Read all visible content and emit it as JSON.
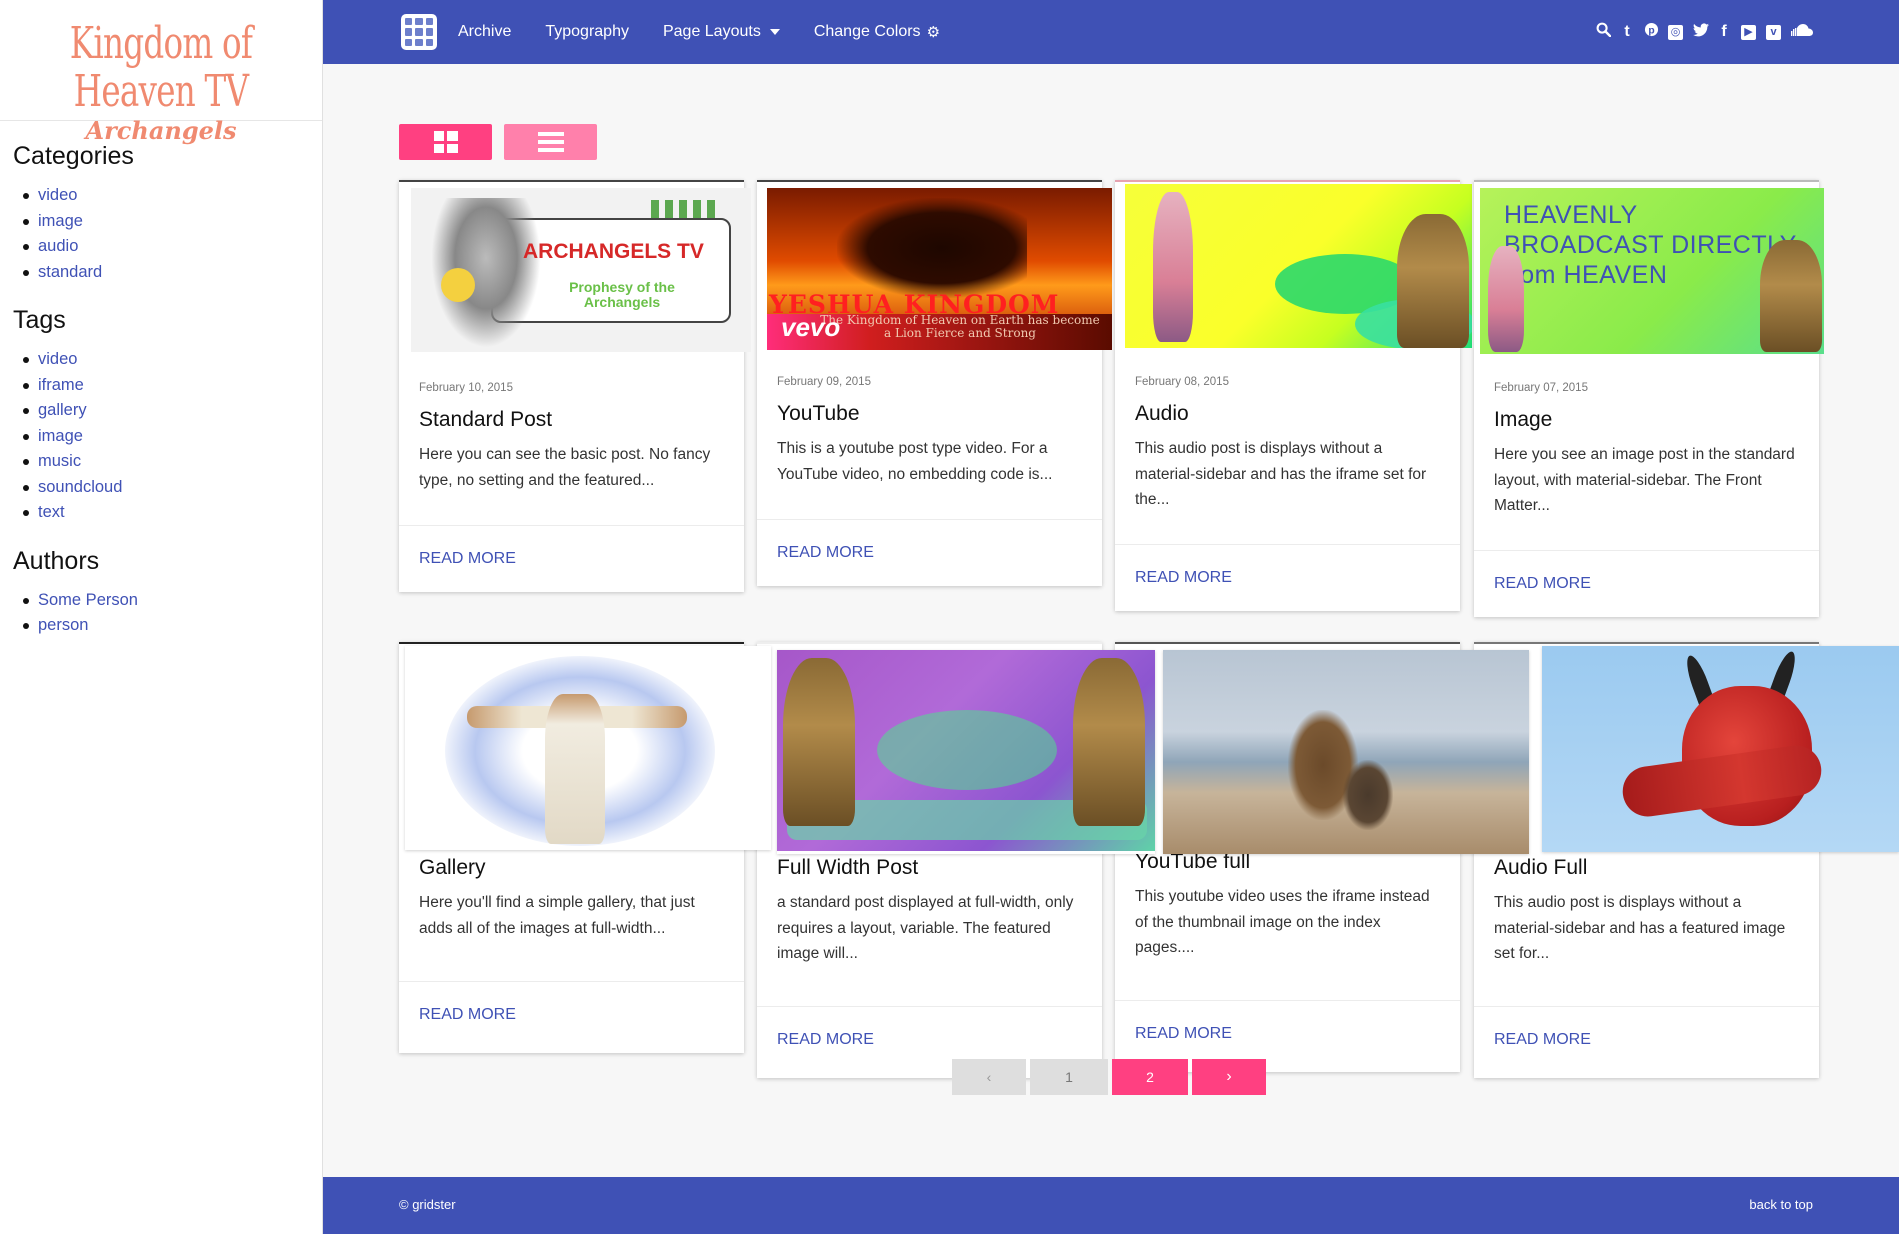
{
  "logo": {
    "title": "Kingdom of Heaven TV",
    "subtitle": "Archangels"
  },
  "sidebar": {
    "categories": {
      "heading": "Categories",
      "items": [
        "video",
        "image",
        "audio",
        "standard"
      ]
    },
    "tags": {
      "heading": "Tags",
      "items": [
        "video",
        "iframe",
        "gallery",
        "image",
        "music",
        "soundcloud",
        "text"
      ]
    },
    "authors": {
      "heading": "Authors",
      "items": [
        "Some Person",
        "person"
      ]
    }
  },
  "nav": {
    "archive": "Archive",
    "typography": "Typography",
    "page_layouts": "Page Layouts",
    "change_colors": "Change Colors"
  },
  "social_icons": [
    "search-icon",
    "tumblr-icon",
    "pinterest-icon",
    "instagram-icon",
    "twitter-icon",
    "facebook-icon",
    "youtube-icon",
    "vimeo-icon",
    "soundcloud-icon"
  ],
  "colors": {
    "primary": "#3f51b5",
    "accent": "#ff4081",
    "accent_light": "#ff80ab",
    "background": "#f7f7f7"
  },
  "posts": [
    {
      "date": "February 10, 2015",
      "title": "Standard Post",
      "excerpt": "Here you can see the basic post. No fancy type, no setting and the featured...",
      "read_more": "READ MORE",
      "image_text": "ARCHANGELS TV",
      "image_caption": "Prophesy of the Archangels"
    },
    {
      "date": "February 09, 2015",
      "title": "YouTube",
      "excerpt": "This is a youtube post type video. For a YouTube video, no embedding code is...",
      "read_more": "READ MORE",
      "image_text": "YESHUA KINGDOM",
      "image_brand": "vevo",
      "image_caption": "The Kingdom of Heaven on Earth has become a Lion Fierce and Strong"
    },
    {
      "date": "February 08, 2015",
      "title": "Audio",
      "excerpt": "This audio post is displays without a material-sidebar and has the iframe set for the...",
      "read_more": "READ MORE"
    },
    {
      "date": "February 07, 2015",
      "title": "Image",
      "excerpt": "Here you see an image post in the standard layout, with material-sidebar. The Front Matter...",
      "read_more": "READ MORE",
      "image_text": "HEAVENLY   BROADCAST DIRECTLY from HEAVEN"
    },
    {
      "title": "Gallery",
      "excerpt": "Here you'll find a simple gallery, that just adds all of the images at full-width...",
      "read_more": "READ MORE"
    },
    {
      "title": "Full Width Post",
      "excerpt": "a standard post displayed at full-width, only requires a layout, variable. The featured image will...",
      "read_more": "READ MORE"
    },
    {
      "title": "YouTube full",
      "excerpt": "This youtube video uses the iframe instead of the thumbnail image on the index pages....",
      "read_more": "READ MORE"
    },
    {
      "title": "Audio Full",
      "excerpt": "This audio post is displays without a material-sidebar and has a featured image set for...",
      "read_more": "READ MORE"
    }
  ],
  "pagination": {
    "prev": "‹",
    "pages": [
      "1",
      "2"
    ],
    "current": "2",
    "next": "›"
  },
  "footer": {
    "copyright": "© gridster",
    "back_to_top": "back to top"
  }
}
